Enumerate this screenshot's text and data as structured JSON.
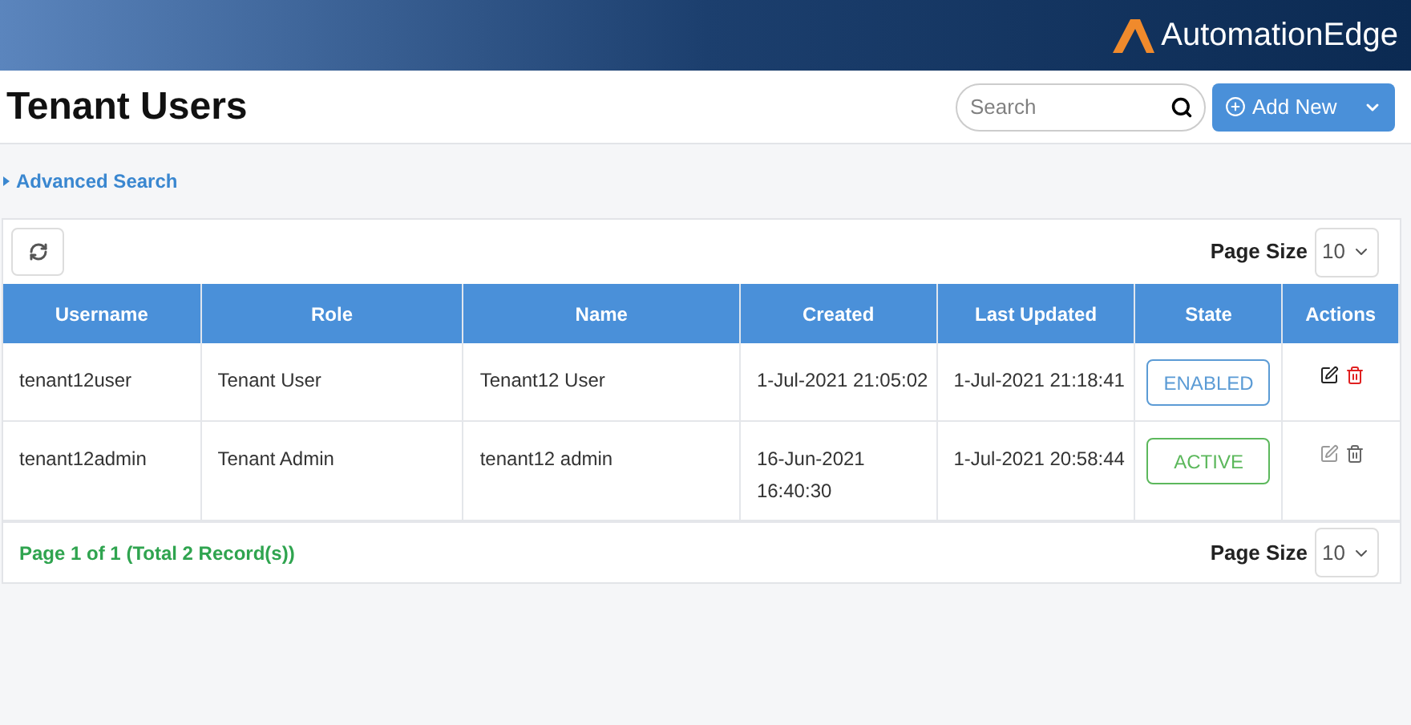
{
  "brand": {
    "name": "AutomationEdge"
  },
  "title": "Tenant Users",
  "search": {
    "placeholder": "Search"
  },
  "add_button": {
    "label": "Add New"
  },
  "advanced_search": {
    "label": "Advanced Search",
    "expanded": false
  },
  "page_size_top": {
    "label": "Page Size",
    "value": "10"
  },
  "table": {
    "columns": [
      "Username",
      "Role",
      "Name",
      "Created",
      "Last Updated",
      "State",
      "Actions"
    ],
    "rows": [
      {
        "username": "tenant12user",
        "role": "Tenant User",
        "name": "Tenant12 User",
        "created": "1-Jul-2021 21:05:02",
        "updated": "1-Jul-2021 21:18:41",
        "state": {
          "label": "ENABLED",
          "color": "#5b9bd5"
        },
        "actions_disabled": false
      },
      {
        "username": "tenant12admin",
        "role": "Tenant Admin",
        "name": "tenant12 admin",
        "created": "16-Jun-2021 16:40:30",
        "updated": "1-Jul-2021 20:58:44",
        "state": {
          "label": "ACTIVE",
          "color": "#5cb85c"
        },
        "actions_disabled": true
      }
    ]
  },
  "pagination": {
    "summary": "Page 1 of 1 (Total 2 Record(s))"
  },
  "page_size_bottom": {
    "label": "Page Size",
    "value": "10"
  }
}
